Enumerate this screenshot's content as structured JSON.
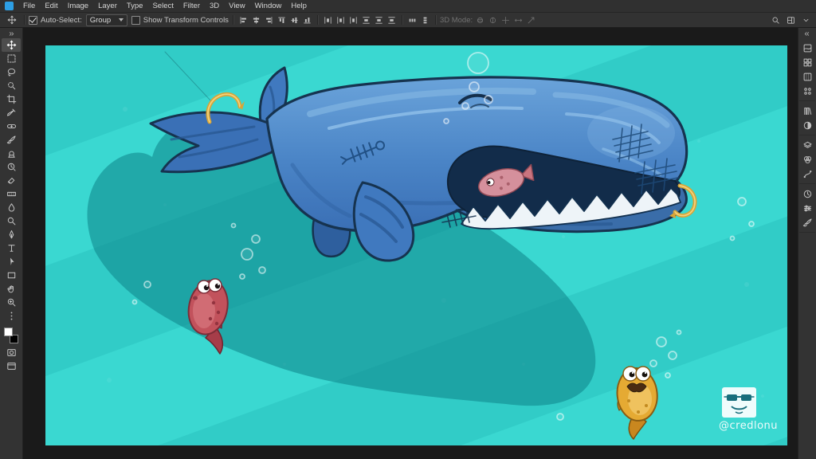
{
  "app": {
    "name": "Photoshop",
    "accent_color": "#2d9fe5"
  },
  "menubar": {
    "items": [
      "File",
      "Edit",
      "Image",
      "Layer",
      "Type",
      "Select",
      "Filter",
      "3D",
      "View",
      "Window",
      "Help"
    ]
  },
  "options_bar": {
    "active_tool": "move",
    "auto_select": {
      "label": "Auto-Select:",
      "checked": true,
      "value": "Group"
    },
    "show_transform": {
      "label": "Show Transform Controls",
      "checked": false
    },
    "align_icons": [
      "align-left-edges",
      "align-horizontal-centers",
      "align-right-edges",
      "align-top-edges",
      "align-vertical-centers",
      "align-bottom-edges"
    ],
    "distribute_icons": [
      "distribute-top-edges",
      "distribute-vertical-centers",
      "distribute-bottom-edges",
      "distribute-left-edges",
      "distribute-horizontal-centers",
      "distribute-right-edges"
    ],
    "spacing_icons": [
      "distribute-horizontal-spacing",
      "distribute-vertical-spacing"
    ],
    "mode_3d": {
      "label": "3D Mode:",
      "icons": [
        "3d-rotate",
        "3d-roll",
        "3d-drag",
        "3d-slide",
        "3d-scale"
      ]
    },
    "right_icons": [
      "search",
      "choose-workspace",
      "more-options"
    ]
  },
  "toolbar": {
    "header_icon": "chevrons",
    "tools": [
      "move",
      "marquee",
      "lasso",
      "quick-select",
      "crop",
      "eyedropper",
      "spot-healing",
      "brush",
      "clone-stamp",
      "history-brush",
      "eraser",
      "gradient",
      "blur",
      "dodge",
      "pen",
      "type",
      "path-selection",
      "rectangle",
      "hand",
      "zoom"
    ],
    "active_tool_index": 0,
    "footer_icons": [
      "ellipsis",
      "quick-mask",
      "screen-mode"
    ],
    "foreground_color": "#ffffff",
    "background_color": "#000000"
  },
  "right_dock": {
    "header_icon": "chevrons",
    "groups": [
      [
        "color",
        "swatches",
        "gradients",
        "patterns"
      ],
      [
        "libraries",
        "adjustments"
      ],
      [
        "layers",
        "channels",
        "paths"
      ],
      [
        "history",
        "properties",
        "brushes"
      ]
    ]
  },
  "canvas": {
    "background_color": "#38d6d0",
    "watermark_handle": "@credlonu"
  }
}
